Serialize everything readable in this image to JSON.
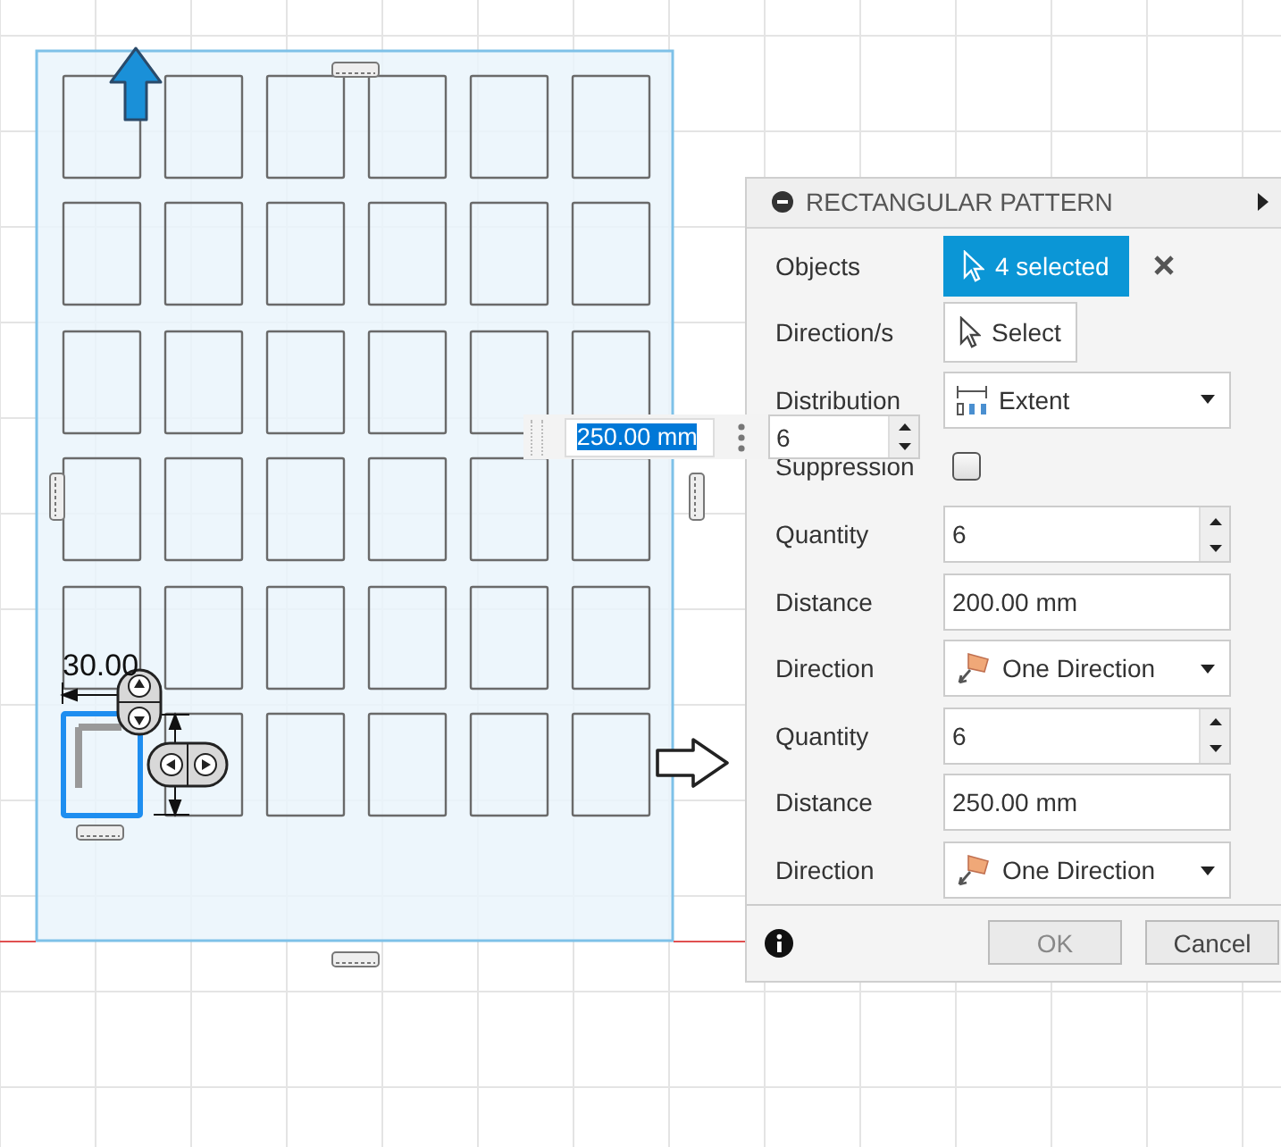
{
  "canvas": {
    "dimension": "30.00"
  },
  "floating_input": {
    "distance": "250.00 mm",
    "distance_selected": true,
    "quantity": "6"
  },
  "dialog": {
    "title": "RECTANGULAR PATTERN",
    "rows": [
      {
        "kind": "selection",
        "label": "Objects",
        "value": "4 selected"
      },
      {
        "kind": "select",
        "label": "Direction/s",
        "value": "Select"
      },
      {
        "kind": "distribution",
        "label": "Distribution",
        "value": "Extent"
      },
      {
        "kind": "checkbox",
        "label": "Suppression",
        "checked": false
      },
      {
        "kind": "spinner",
        "label": "Quantity",
        "value": "6"
      },
      {
        "kind": "text",
        "label": "Distance",
        "value": "200.00 mm"
      },
      {
        "kind": "direction",
        "label": "Direction",
        "value": "One Direction"
      },
      {
        "kind": "spinner",
        "label": "Quantity",
        "value": "6"
      },
      {
        "kind": "text",
        "label": "Distance",
        "value": "250.00 mm"
      },
      {
        "kind": "direction",
        "label": "Direction",
        "value": "One Direction"
      }
    ],
    "buttons": [
      {
        "label": "OK",
        "disabled": true
      },
      {
        "label": "Cancel",
        "disabled": false
      }
    ]
  }
}
